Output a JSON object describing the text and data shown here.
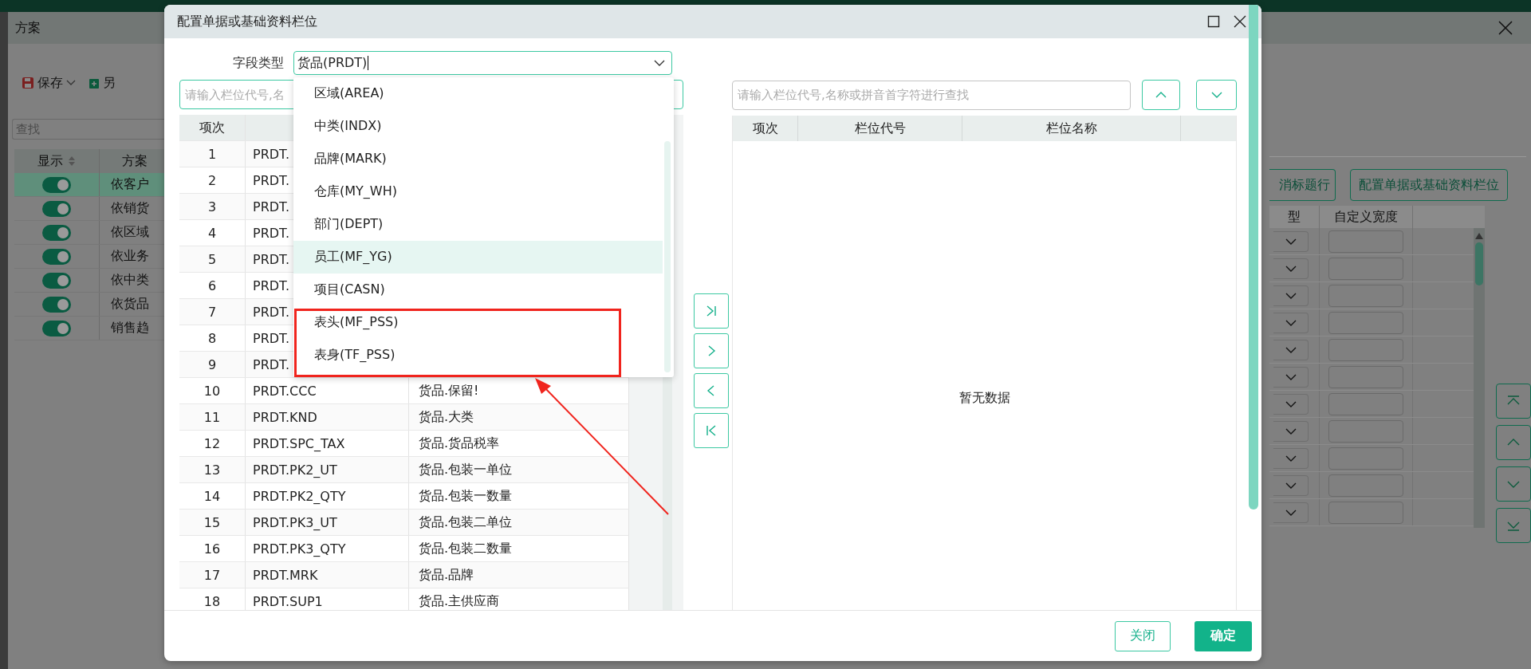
{
  "app_window": {
    "title": "方案",
    "toolbar": {
      "save_label": "保存",
      "save_as_label": "另"
    },
    "search": {
      "placeholder": "查找"
    },
    "table": {
      "columns": [
        "显示",
        "方案"
      ],
      "rows": [
        {
          "name": "依客户",
          "on": true,
          "selected": true
        },
        {
          "name": "依销货",
          "on": true,
          "selected": false
        },
        {
          "name": "依区域",
          "on": true,
          "selected": false
        },
        {
          "name": "依业务",
          "on": true,
          "selected": false
        },
        {
          "name": "依中类",
          "on": true,
          "selected": false
        },
        {
          "name": "依货品",
          "on": true,
          "selected": false
        },
        {
          "name": "销售趋",
          "on": true,
          "selected": false
        }
      ]
    }
  },
  "right_panel": {
    "buttons": [
      "消标题行",
      "配置单据或基础资料栏位"
    ],
    "columns": [
      "型",
      "自定义宽度"
    ]
  },
  "dialog": {
    "title": "配置单据或基础资料栏位",
    "field_type": {
      "label": "字段类型",
      "value": "货品(PRDT)"
    },
    "dropdown": {
      "options": [
        {
          "label": "区域(AREA)",
          "selected": false
        },
        {
          "label": "中类(INDX)",
          "selected": false
        },
        {
          "label": "品牌(MARK)",
          "selected": false
        },
        {
          "label": "仓库(MY_WH)",
          "selected": false
        },
        {
          "label": "部门(DEPT)",
          "selected": false
        },
        {
          "label": "员工(MF_YG)",
          "selected": true
        },
        {
          "label": "项目(CASN)",
          "selected": false
        },
        {
          "label": "表头(MF_PSS)",
          "selected": false
        },
        {
          "label": "表身(TF_PSS)",
          "selected": false
        }
      ]
    },
    "left_search": {
      "placeholder": "请输入栏位代号,名"
    },
    "left_table": {
      "columns": [
        "项次"
      ],
      "rows": [
        {
          "no": "1",
          "code": "PRDT."
        },
        {
          "no": "2",
          "code": "PRDT."
        },
        {
          "no": "3",
          "code": "PRDT."
        },
        {
          "no": "4",
          "code": "PRDT."
        },
        {
          "no": "5",
          "code": "PRDT."
        },
        {
          "no": "6",
          "code": "PRDT."
        },
        {
          "no": "7",
          "code": "PRDT."
        },
        {
          "no": "8",
          "code": "PRDT."
        },
        {
          "no": "9",
          "code": "PRDT."
        },
        {
          "no": "10",
          "code": "PRDT.CCC",
          "name": "货品.保留!"
        },
        {
          "no": "11",
          "code": "PRDT.KND",
          "name": "货品.大类"
        },
        {
          "no": "12",
          "code": "PRDT.SPC_TAX",
          "name": "货品.货品税率"
        },
        {
          "no": "13",
          "code": "PRDT.PK2_UT",
          "name": "货品.包装一单位"
        },
        {
          "no": "14",
          "code": "PRDT.PK2_QTY",
          "name": "货品.包装一数量"
        },
        {
          "no": "15",
          "code": "PRDT.PK3_UT",
          "name": "货品.包装二单位"
        },
        {
          "no": "16",
          "code": "PRDT.PK3_QTY",
          "name": "货品.包装二数量"
        },
        {
          "no": "17",
          "code": "PRDT.MRK",
          "name": "货品.品牌"
        },
        {
          "no": "18",
          "code": "PRDT.SUP1",
          "name": "货品.主供应商"
        }
      ]
    },
    "right_search": {
      "placeholder": "请输入栏位代号,名称或拼音首字符进行查找"
    },
    "right_table": {
      "columns": [
        "项次",
        "栏位代号",
        "栏位名称"
      ],
      "empty_text": "暂无数据"
    },
    "buttons": [
      {
        "label": "关闭",
        "kind": "secondary"
      },
      {
        "label": "确定",
        "kind": "primary"
      }
    ]
  }
}
